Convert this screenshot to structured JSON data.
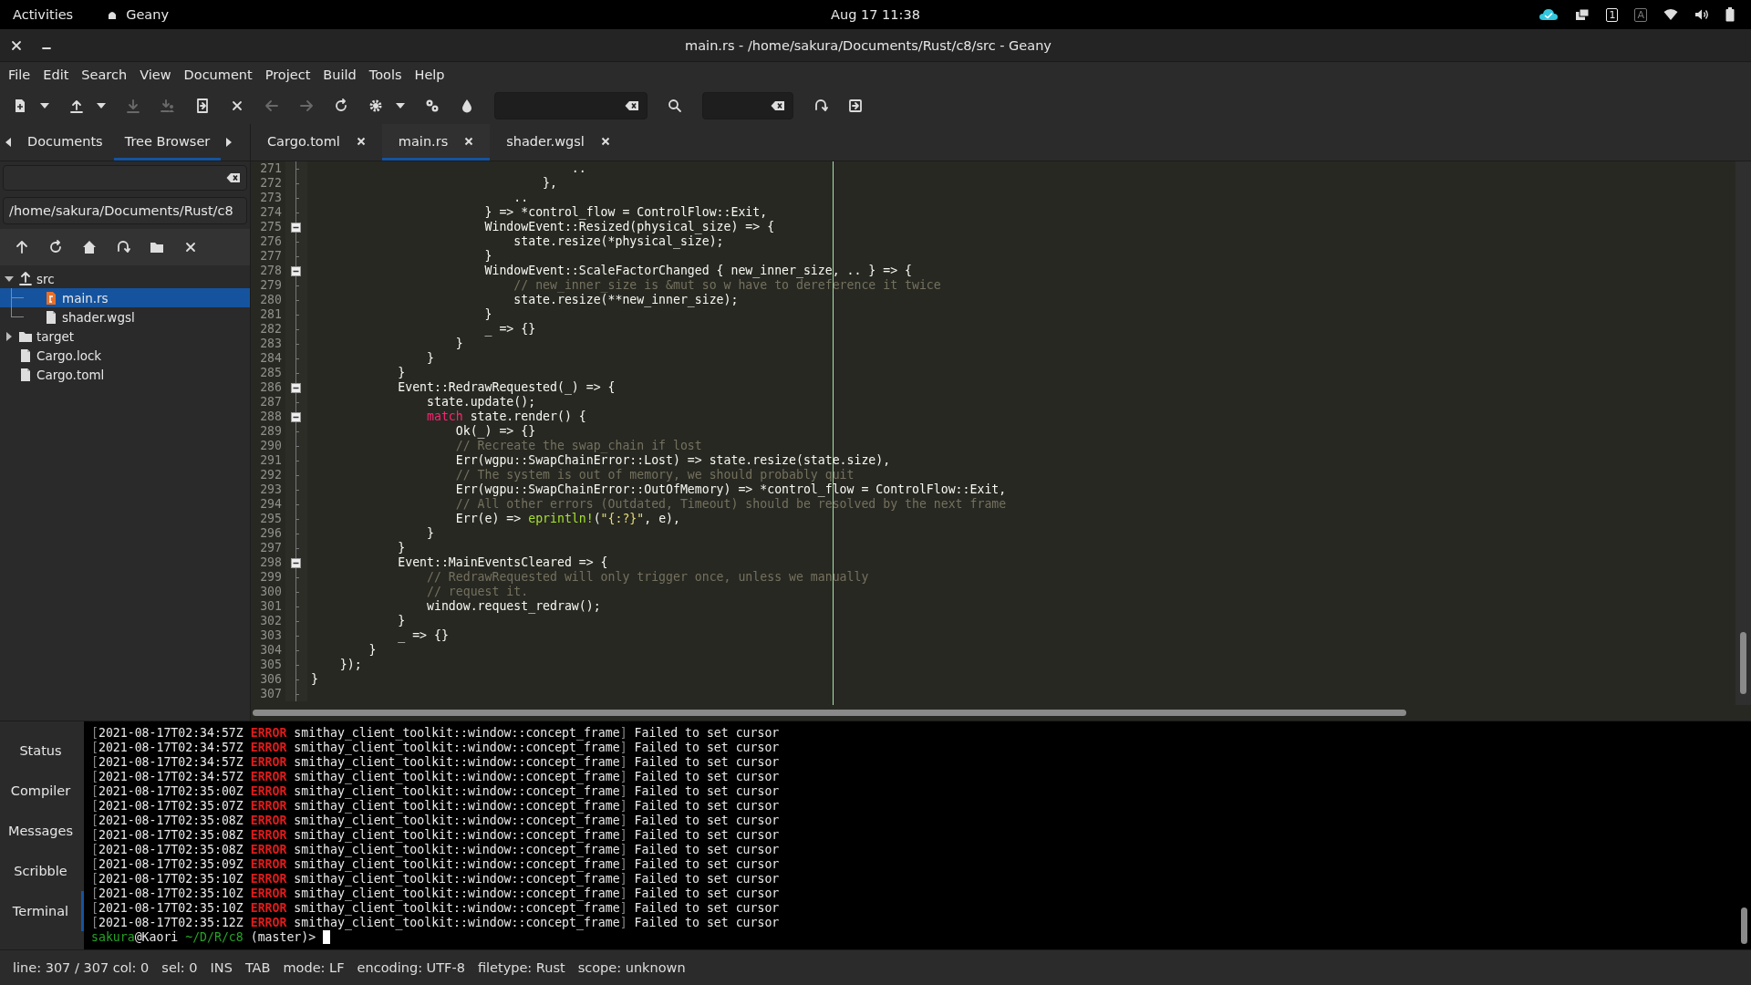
{
  "top_bar": {
    "activities": "Activities",
    "app": "Geany",
    "clock": "Aug 17  11:38",
    "tray": [
      {
        "kind": "cloud"
      },
      {
        "kind": "window"
      },
      {
        "kind": "badge",
        "text": "1",
        "active": true
      },
      {
        "kind": "badge",
        "text": "A",
        "active": false
      },
      {
        "kind": "wifi"
      },
      {
        "kind": "volume"
      },
      {
        "kind": "battery"
      }
    ]
  },
  "window": {
    "title": "main.rs - /home/sakura/Documents/Rust/c8/src - Geany"
  },
  "menu": [
    "File",
    "Edit",
    "Search",
    "View",
    "Document",
    "Project",
    "Build",
    "Tools",
    "Help"
  ],
  "toolbar": {
    "groups": [
      {
        "items": [
          {
            "kind": "button",
            "disabled": false
          },
          {
            "kind": "menu",
            "disabled": false
          },
          {
            "kind": "button",
            "disabled": false
          },
          {
            "kind": "menu",
            "disabled": false
          },
          {
            "kind": "button",
            "disabled": true
          },
          {
            "kind": "button",
            "disabled": true
          }
        ]
      },
      {
        "items": [
          {
            "kind": "button",
            "disabled": false
          },
          {
            "kind": "button",
            "disabled": false
          }
        ]
      },
      {
        "items": [
          {
            "kind": "button",
            "disabled": true
          },
          {
            "kind": "button",
            "disabled": true
          }
        ]
      },
      {
        "items": [
          {
            "kind": "button",
            "disabled": false
          },
          {
            "kind": "button",
            "disabled": false
          },
          {
            "kind": "menu",
            "disabled": false
          },
          {
            "kind": "button",
            "disabled": false
          }
        ]
      },
      {
        "items": [
          {
            "kind": "button",
            "disabled": false
          }
        ]
      },
      {
        "items": [
          {
            "kind": "field",
            "disabled": false
          },
          {
            "kind": "button",
            "disabled": false
          },
          {
            "kind": "field",
            "disabled": false
          },
          {
            "kind": "button",
            "disabled": false
          }
        ]
      },
      {
        "items": [
          {
            "kind": "button",
            "disabled": false
          }
        ]
      }
    ]
  },
  "sidebar": {
    "tabs": [
      {
        "label": "Documents",
        "selected": false
      },
      {
        "label": "Tree Browser",
        "selected": true
      }
    ],
    "path": "/home/sakura/Documents/Rust/c8",
    "tree": [
      {
        "label": "src",
        "kind": "parent",
        "expanded": true,
        "selected": false,
        "children": [
          {
            "label": "main.rs",
            "kind": "rust",
            "selected": true
          },
          {
            "label": "shader.wgsl",
            "kind": "file",
            "selected": false
          }
        ]
      },
      {
        "label": "target",
        "kind": "folder",
        "expanded": false,
        "selected": false
      },
      {
        "label": "Cargo.lock",
        "kind": "file",
        "selected": false
      },
      {
        "label": "Cargo.toml",
        "kind": "file",
        "selected": false
      }
    ]
  },
  "editor": {
    "tabs": [
      {
        "label": "Cargo.toml",
        "selected": false
      },
      {
        "label": "main.rs",
        "selected": true
      },
      {
        "label": "shader.wgsl",
        "selected": false
      }
    ],
    "lines": [
      {
        "number": "271",
        "fold_start": false,
        "segments": [
          {
            "kind": "code",
            "text": "                                    .."
          }
        ]
      },
      {
        "number": "272",
        "fold_start": false,
        "segments": [
          {
            "kind": "code",
            "text": "                                },"
          }
        ]
      },
      {
        "number": "273",
        "fold_start": false,
        "segments": [
          {
            "kind": "code",
            "text": "                            .."
          }
        ]
      },
      {
        "number": "274",
        "fold_start": false,
        "segments": [
          {
            "kind": "code",
            "text": "                        } => *control_flow = ControlFlow::Exit,"
          }
        ]
      },
      {
        "number": "275",
        "fold_start": true,
        "segments": [
          {
            "kind": "code",
            "text": "                        WindowEvent::Resized(physical_size) => {"
          }
        ]
      },
      {
        "number": "276",
        "fold_start": false,
        "segments": [
          {
            "kind": "code",
            "text": "                            state.resize(*physical_size);"
          }
        ]
      },
      {
        "number": "277",
        "fold_start": false,
        "segments": [
          {
            "kind": "code",
            "text": "                        }"
          }
        ]
      },
      {
        "number": "278",
        "fold_start": true,
        "segments": [
          {
            "kind": "code",
            "text": "                        WindowEvent::ScaleFactorChanged { new_inner_size, .. } => {"
          }
        ]
      },
      {
        "number": "279",
        "fold_start": false,
        "segments": [
          {
            "kind": "comment",
            "text": "                            // new_inner_size is &mut so w have to dereference it twice"
          }
        ]
      },
      {
        "number": "280",
        "fold_start": false,
        "segments": [
          {
            "kind": "code",
            "text": "                            state.resize(**new_inner_size);"
          }
        ]
      },
      {
        "number": "281",
        "fold_start": false,
        "segments": [
          {
            "kind": "code",
            "text": "                        }"
          }
        ]
      },
      {
        "number": "282",
        "fold_start": false,
        "segments": [
          {
            "kind": "code",
            "text": "                        _ => {}"
          }
        ]
      },
      {
        "number": "283",
        "fold_start": false,
        "segments": [
          {
            "kind": "code",
            "text": "                    }"
          }
        ]
      },
      {
        "number": "284",
        "fold_start": false,
        "segments": [
          {
            "kind": "code",
            "text": "                }"
          }
        ]
      },
      {
        "number": "285",
        "fold_start": false,
        "segments": [
          {
            "kind": "code",
            "text": "            }"
          }
        ]
      },
      {
        "number": "286",
        "fold_start": true,
        "segments": [
          {
            "kind": "code",
            "text": "            Event::RedrawRequested(_) => {"
          }
        ]
      },
      {
        "number": "287",
        "fold_start": false,
        "segments": [
          {
            "kind": "code",
            "text": "                state.update();"
          }
        ]
      },
      {
        "number": "288",
        "fold_start": true,
        "segments": [
          {
            "kind": "keyword",
            "text": "                match"
          },
          {
            "kind": "code",
            "text": " state.render() {"
          }
        ]
      },
      {
        "number": "289",
        "fold_start": false,
        "segments": [
          {
            "kind": "code",
            "text": "                    Ok(_) => {}"
          }
        ]
      },
      {
        "number": "290",
        "fold_start": false,
        "segments": [
          {
            "kind": "comment",
            "text": "                    // Recreate the swap_chain if lost"
          }
        ]
      },
      {
        "number": "291",
        "fold_start": false,
        "segments": [
          {
            "kind": "code",
            "text": "                    Err(wgpu::SwapChainError::Lost) => state.resize(state.size),"
          }
        ]
      },
      {
        "number": "292",
        "fold_start": false,
        "segments": [
          {
            "kind": "comment",
            "text": "                    // The system is out of memory, we should probably quit"
          }
        ]
      },
      {
        "number": "293",
        "fold_start": false,
        "segments": [
          {
            "kind": "code",
            "text": "                    Err(wgpu::SwapChainError::OutOfMemory) => *control_flow = ControlFlow::Exit,"
          }
        ]
      },
      {
        "number": "294",
        "fold_start": false,
        "segments": [
          {
            "kind": "comment",
            "text": "                    // All other errors (Outdated, Timeout) should be resolved by the next frame"
          }
        ]
      },
      {
        "number": "295",
        "fold_start": false,
        "segments": [
          {
            "kind": "code",
            "text": "                    Err(e) => "
          },
          {
            "kind": "macro",
            "text": "eprintln!"
          },
          {
            "kind": "code",
            "text": "("
          },
          {
            "kind": "string",
            "text": "\"{:?}\""
          },
          {
            "kind": "code",
            "text": ", e),"
          }
        ]
      },
      {
        "number": "296",
        "fold_start": false,
        "segments": [
          {
            "kind": "code",
            "text": "                }"
          }
        ]
      },
      {
        "number": "297",
        "fold_start": false,
        "segments": [
          {
            "kind": "code",
            "text": "            }"
          }
        ]
      },
      {
        "number": "298",
        "fold_start": true,
        "segments": [
          {
            "kind": "code",
            "text": "            Event::MainEventsCleared => {"
          }
        ]
      },
      {
        "number": "299",
        "fold_start": false,
        "segments": [
          {
            "kind": "comment",
            "text": "                // RedrawRequested will only trigger once, unless we manually"
          }
        ]
      },
      {
        "number": "300",
        "fold_start": false,
        "segments": [
          {
            "kind": "comment",
            "text": "                // request it."
          }
        ]
      },
      {
        "number": "301",
        "fold_start": false,
        "segments": [
          {
            "kind": "code",
            "text": "                window.request_redraw();"
          }
        ]
      },
      {
        "number": "302",
        "fold_start": false,
        "segments": [
          {
            "kind": "code",
            "text": "            }"
          }
        ]
      },
      {
        "number": "303",
        "fold_start": false,
        "segments": [
          {
            "kind": "code",
            "text": "            _ => {}"
          }
        ]
      },
      {
        "number": "304",
        "fold_start": false,
        "segments": [
          {
            "kind": "code",
            "text": "        }"
          }
        ]
      },
      {
        "number": "305",
        "fold_start": false,
        "segments": [
          {
            "kind": "code",
            "text": "    });"
          }
        ]
      },
      {
        "number": "306",
        "fold_start": false,
        "segments": [
          {
            "kind": "code",
            "text": "}"
          }
        ]
      },
      {
        "number": "307",
        "fold_start": false
      }
    ]
  },
  "bottom_panel": {
    "tabs": [
      {
        "label": "Status",
        "selected": false
      },
      {
        "label": "Compiler",
        "selected": false
      },
      {
        "label": "Messages",
        "selected": false
      },
      {
        "label": "Scribble",
        "selected": false
      },
      {
        "label": "Terminal",
        "selected": true
      }
    ],
    "terminal": {
      "lines": [
        {
          "segments": [
            {
              "kind": "dim",
              "text": "["
            },
            {
              "kind": "plain",
              "text": "2021-08-17T02:34:57Z "
            },
            {
              "kind": "error",
              "text": "ERROR"
            },
            {
              "kind": "plain",
              "text": " smithay_client_toolkit::window::concept_frame"
            },
            {
              "kind": "dim",
              "text": "]"
            },
            {
              "kind": "plain",
              "text": " Failed to set cursor"
            }
          ]
        },
        {
          "segments": [
            {
              "kind": "dim",
              "text": "["
            },
            {
              "kind": "plain",
              "text": "2021-08-17T02:34:57Z "
            },
            {
              "kind": "error",
              "text": "ERROR"
            },
            {
              "kind": "plain",
              "text": " smithay_client_toolkit::window::concept_frame"
            },
            {
              "kind": "dim",
              "text": "]"
            },
            {
              "kind": "plain",
              "text": " Failed to set cursor"
            }
          ]
        },
        {
          "segments": [
            {
              "kind": "dim",
              "text": "["
            },
            {
              "kind": "plain",
              "text": "2021-08-17T02:34:57Z "
            },
            {
              "kind": "error",
              "text": "ERROR"
            },
            {
              "kind": "plain",
              "text": " smithay_client_toolkit::window::concept_frame"
            },
            {
              "kind": "dim",
              "text": "]"
            },
            {
              "kind": "plain",
              "text": " Failed to set cursor"
            }
          ]
        },
        {
          "segments": [
            {
              "kind": "dim",
              "text": "["
            },
            {
              "kind": "plain",
              "text": "2021-08-17T02:34:57Z "
            },
            {
              "kind": "error",
              "text": "ERROR"
            },
            {
              "kind": "plain",
              "text": " smithay_client_toolkit::window::concept_frame"
            },
            {
              "kind": "dim",
              "text": "]"
            },
            {
              "kind": "plain",
              "text": " Failed to set cursor"
            }
          ]
        },
        {
          "segments": [
            {
              "kind": "dim",
              "text": "["
            },
            {
              "kind": "plain",
              "text": "2021-08-17T02:35:00Z "
            },
            {
              "kind": "error",
              "text": "ERROR"
            },
            {
              "kind": "plain",
              "text": " smithay_client_toolkit::window::concept_frame"
            },
            {
              "kind": "dim",
              "text": "]"
            },
            {
              "kind": "plain",
              "text": " Failed to set cursor"
            }
          ]
        },
        {
          "segments": [
            {
              "kind": "dim",
              "text": "["
            },
            {
              "kind": "plain",
              "text": "2021-08-17T02:35:07Z "
            },
            {
              "kind": "error",
              "text": "ERROR"
            },
            {
              "kind": "plain",
              "text": " smithay_client_toolkit::window::concept_frame"
            },
            {
              "kind": "dim",
              "text": "]"
            },
            {
              "kind": "plain",
              "text": " Failed to set cursor"
            }
          ]
        },
        {
          "segments": [
            {
              "kind": "dim",
              "text": "["
            },
            {
              "kind": "plain",
              "text": "2021-08-17T02:35:08Z "
            },
            {
              "kind": "error",
              "text": "ERROR"
            },
            {
              "kind": "plain",
              "text": " smithay_client_toolkit::window::concept_frame"
            },
            {
              "kind": "dim",
              "text": "]"
            },
            {
              "kind": "plain",
              "text": " Failed to set cursor"
            }
          ]
        },
        {
          "segments": [
            {
              "kind": "dim",
              "text": "["
            },
            {
              "kind": "plain",
              "text": "2021-08-17T02:35:08Z "
            },
            {
              "kind": "error",
              "text": "ERROR"
            },
            {
              "kind": "plain",
              "text": " smithay_client_toolkit::window::concept_frame"
            },
            {
              "kind": "dim",
              "text": "]"
            },
            {
              "kind": "plain",
              "text": " Failed to set cursor"
            }
          ]
        },
        {
          "segments": [
            {
              "kind": "dim",
              "text": "["
            },
            {
              "kind": "plain",
              "text": "2021-08-17T02:35:08Z "
            },
            {
              "kind": "error",
              "text": "ERROR"
            },
            {
              "kind": "plain",
              "text": " smithay_client_toolkit::window::concept_frame"
            },
            {
              "kind": "dim",
              "text": "]"
            },
            {
              "kind": "plain",
              "text": " Failed to set cursor"
            }
          ]
        },
        {
          "segments": [
            {
              "kind": "dim",
              "text": "["
            },
            {
              "kind": "plain",
              "text": "2021-08-17T02:35:09Z "
            },
            {
              "kind": "error",
              "text": "ERROR"
            },
            {
              "kind": "plain",
              "text": " smithay_client_toolkit::window::concept_frame"
            },
            {
              "kind": "dim",
              "text": "]"
            },
            {
              "kind": "plain",
              "text": " Failed to set cursor"
            }
          ]
        },
        {
          "segments": [
            {
              "kind": "dim",
              "text": "["
            },
            {
              "kind": "plain",
              "text": "2021-08-17T02:35:10Z "
            },
            {
              "kind": "error",
              "text": "ERROR"
            },
            {
              "kind": "plain",
              "text": " smithay_client_toolkit::window::concept_frame"
            },
            {
              "kind": "dim",
              "text": "]"
            },
            {
              "kind": "plain",
              "text": " Failed to set cursor"
            }
          ]
        },
        {
          "segments": [
            {
              "kind": "dim",
              "text": "["
            },
            {
              "kind": "plain",
              "text": "2021-08-17T02:35:10Z "
            },
            {
              "kind": "error",
              "text": "ERROR"
            },
            {
              "kind": "plain",
              "text": " smithay_client_toolkit::window::concept_frame"
            },
            {
              "kind": "dim",
              "text": "]"
            },
            {
              "kind": "plain",
              "text": " Failed to set cursor"
            }
          ]
        },
        {
          "segments": [
            {
              "kind": "dim",
              "text": "["
            },
            {
              "kind": "plain",
              "text": "2021-08-17T02:35:10Z "
            },
            {
              "kind": "error",
              "text": "ERROR"
            },
            {
              "kind": "plain",
              "text": " smithay_client_toolkit::window::concept_frame"
            },
            {
              "kind": "dim",
              "text": "]"
            },
            {
              "kind": "plain",
              "text": " Failed to set cursor"
            }
          ]
        },
        {
          "segments": [
            {
              "kind": "dim",
              "text": "["
            },
            {
              "kind": "plain",
              "text": "2021-08-17T02:35:12Z "
            },
            {
              "kind": "error",
              "text": "ERROR"
            },
            {
              "kind": "plain",
              "text": " smithay_client_toolkit::window::concept_frame"
            },
            {
              "kind": "dim",
              "text": "]"
            },
            {
              "kind": "plain",
              "text": " Failed to set cursor"
            }
          ]
        },
        {
          "segments": [
            {
              "kind": "user",
              "text": "sakura"
            },
            {
              "kind": "plain",
              "text": "@Kaori "
            },
            {
              "kind": "user",
              "text": "~/D/R/c8"
            },
            {
              "kind": "plain",
              "text": " (master)> "
            }
          ],
          "cursor": true
        }
      ]
    }
  },
  "status_bar": [
    "line: 307 / 307  col: 0",
    "sel: 0",
    "INS",
    "TAB",
    "mode: LF",
    "encoding: UTF-8",
    "filetype: Rust",
    "scope: unknown"
  ]
}
